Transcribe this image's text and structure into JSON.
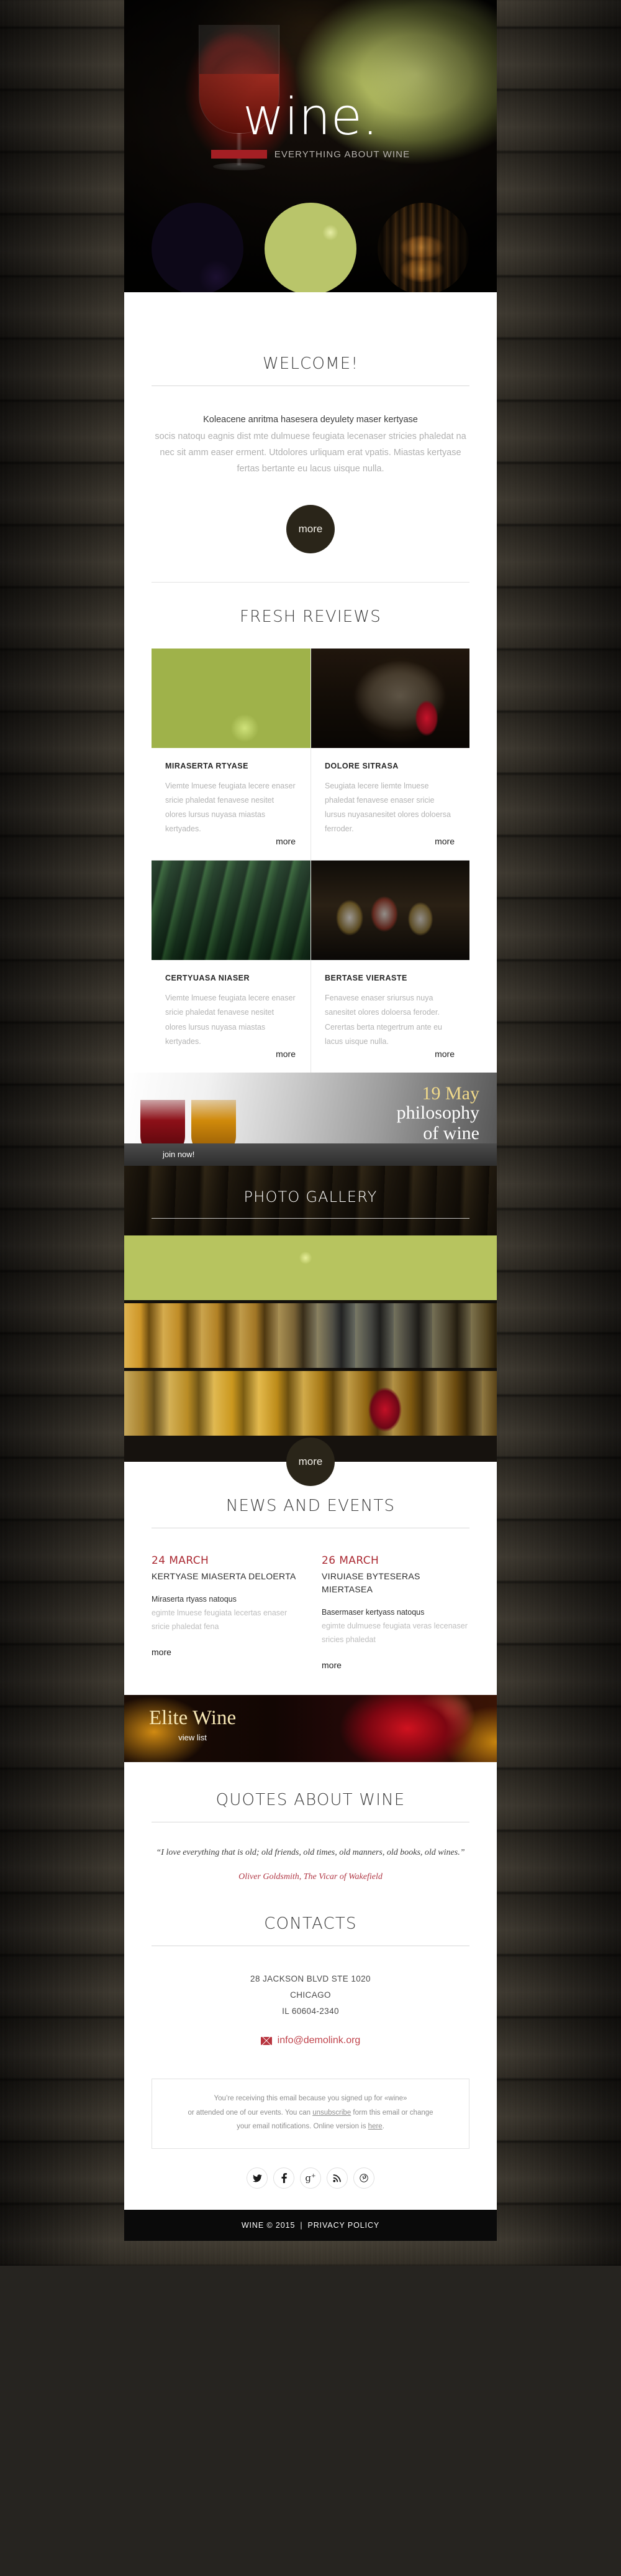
{
  "header": {
    "logo": "wine.",
    "tagline": "EVERYTHING ABOUT WINE",
    "accent_color": "#a41f24",
    "thumbs": [
      "wine-glasses-photo",
      "grapes-photo",
      "wine-cellar-photo"
    ]
  },
  "welcome": {
    "title": "WELCOME!",
    "lead": "Koleacene anritma hasesera deyulety maser kertyase",
    "text": "socis natoqu eagnis dist mte dulmuese feugiata lecenaser stricies phaledat na nec sit amm easer erment. Utdolores urliquam erat vpatis. Miastas kertyase fertas bertante eu lacus uisque nulla.",
    "more_label": "more"
  },
  "reviews": {
    "title": "FRESH REVIEWS",
    "more_label": "more",
    "items": [
      {
        "title": "MIRASERTA RTYASE",
        "text": "Viemte lmuese feugiata lecere enaser sricie phaledat fenavese nesitet olores lursus nuyasa miastas kertyades.",
        "image": "white-wine-glass-with-grapes"
      },
      {
        "title": "DOLORE SITRASA",
        "text": "Seugiata lecere liemte lmuese phaledat fenavese enaser sricie lursus nuyasanesitet olores doloersa ferroder.",
        "image": "wine-barrel-with-red-wine"
      },
      {
        "title": "CERTYUASA NIASER",
        "text": "Viemte lmuese feugiata lecere enaser sricie phaledat fenavese nesitet olores lursus nuyasa miastas kertyades.",
        "image": "wine-bottles-on-straw"
      },
      {
        "title": "BERTASE VIERASTE",
        "text": "Fenavese enaser sriursus nuya sanesitet olores doloersa feroder. Cerertas berta ntegertrum ante eu lacus uisque nulla.",
        "image": "wine-glasses-and-bottles"
      }
    ]
  },
  "promo": {
    "date": "19 May",
    "line1": "philosophy",
    "line2": "of wine",
    "cta": "join now!",
    "date_color": "#f0d98a"
  },
  "gallery": {
    "title": "PHOTO GALLERY",
    "more_label": "more",
    "strips": [
      "grapes-on-barrel",
      "champagne-glasses-row",
      "wine-glasses-amber"
    ]
  },
  "news": {
    "title": "NEWS AND EVENTS",
    "more_label": "more",
    "date_color": "#ab2a33",
    "items": [
      {
        "date": "24 MARCH",
        "title": "KERTYASE MIASERTA DELOERTA",
        "lead": "Miraserta rtyass natoqus",
        "text": "egimte lmuese feugiata lecertas enaser sricie phaledat fena"
      },
      {
        "date": "26 MARCH",
        "title": "VIRUIASE BYTESERAS MIERTASEA",
        "lead": "Basermaser kertyass natoqus",
        "text": "egimte dulmuese feugiata veras lecenaser sricies phaledat"
      }
    ]
  },
  "elite": {
    "name": "Elite Wine",
    "cta": "view list"
  },
  "quotes": {
    "title": "QUOTES ABOUT WINE",
    "text": "“I love everything that is old; old friends, old times, old manners, old books, old wines.”",
    "author": "Oliver Goldsmith, The Vicar of Wakefield"
  },
  "contacts": {
    "title": "CONTACTS",
    "address_line1": "28 JACKSON BLVD STE 1020",
    "address_line2": "CHICAGO",
    "address_line3": "IL 60604-2340",
    "email": "info@demolink.org",
    "email_color": "#c0444c"
  },
  "unsubscribe": {
    "part1": "You’re receiving this email because you signed up for «wine»",
    "part2": "or attended one of our events. You can ",
    "link1": "unsubscribe",
    "part3": " form this email or change",
    "part4": "your email notifications. Online version is ",
    "link2": "here",
    "part5": "."
  },
  "social": [
    {
      "name": "twitter-icon",
      "glyph": "🐦"
    },
    {
      "name": "facebook-icon",
      "glyph": "f"
    },
    {
      "name": "google-plus-icon",
      "glyph": "g⁺"
    },
    {
      "name": "rss-icon",
      "glyph": "⚡"
    },
    {
      "name": "pinterest-icon",
      "glyph": "ⓟ"
    }
  ],
  "footer": {
    "copyright": "WINE © 2015",
    "separator": "|",
    "privacy": "PRIVACY POLICY"
  }
}
